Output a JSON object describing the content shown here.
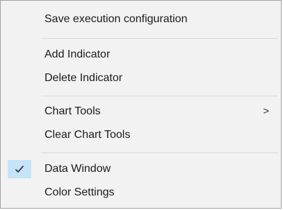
{
  "menu": {
    "items": [
      {
        "label": "Save execution configuration"
      },
      {
        "label": "Add Indicator"
      },
      {
        "label": "Delete Indicator"
      },
      {
        "label": "Chart Tools",
        "submenu_arrow": ">"
      },
      {
        "label": "Clear Chart Tools"
      },
      {
        "label": "Data Window",
        "checked": true
      },
      {
        "label": "Color Settings"
      }
    ],
    "colors": {
      "background": "#f2f2f2",
      "check_highlight": "#c4e4f8",
      "separator": "#d6d6d6"
    }
  }
}
